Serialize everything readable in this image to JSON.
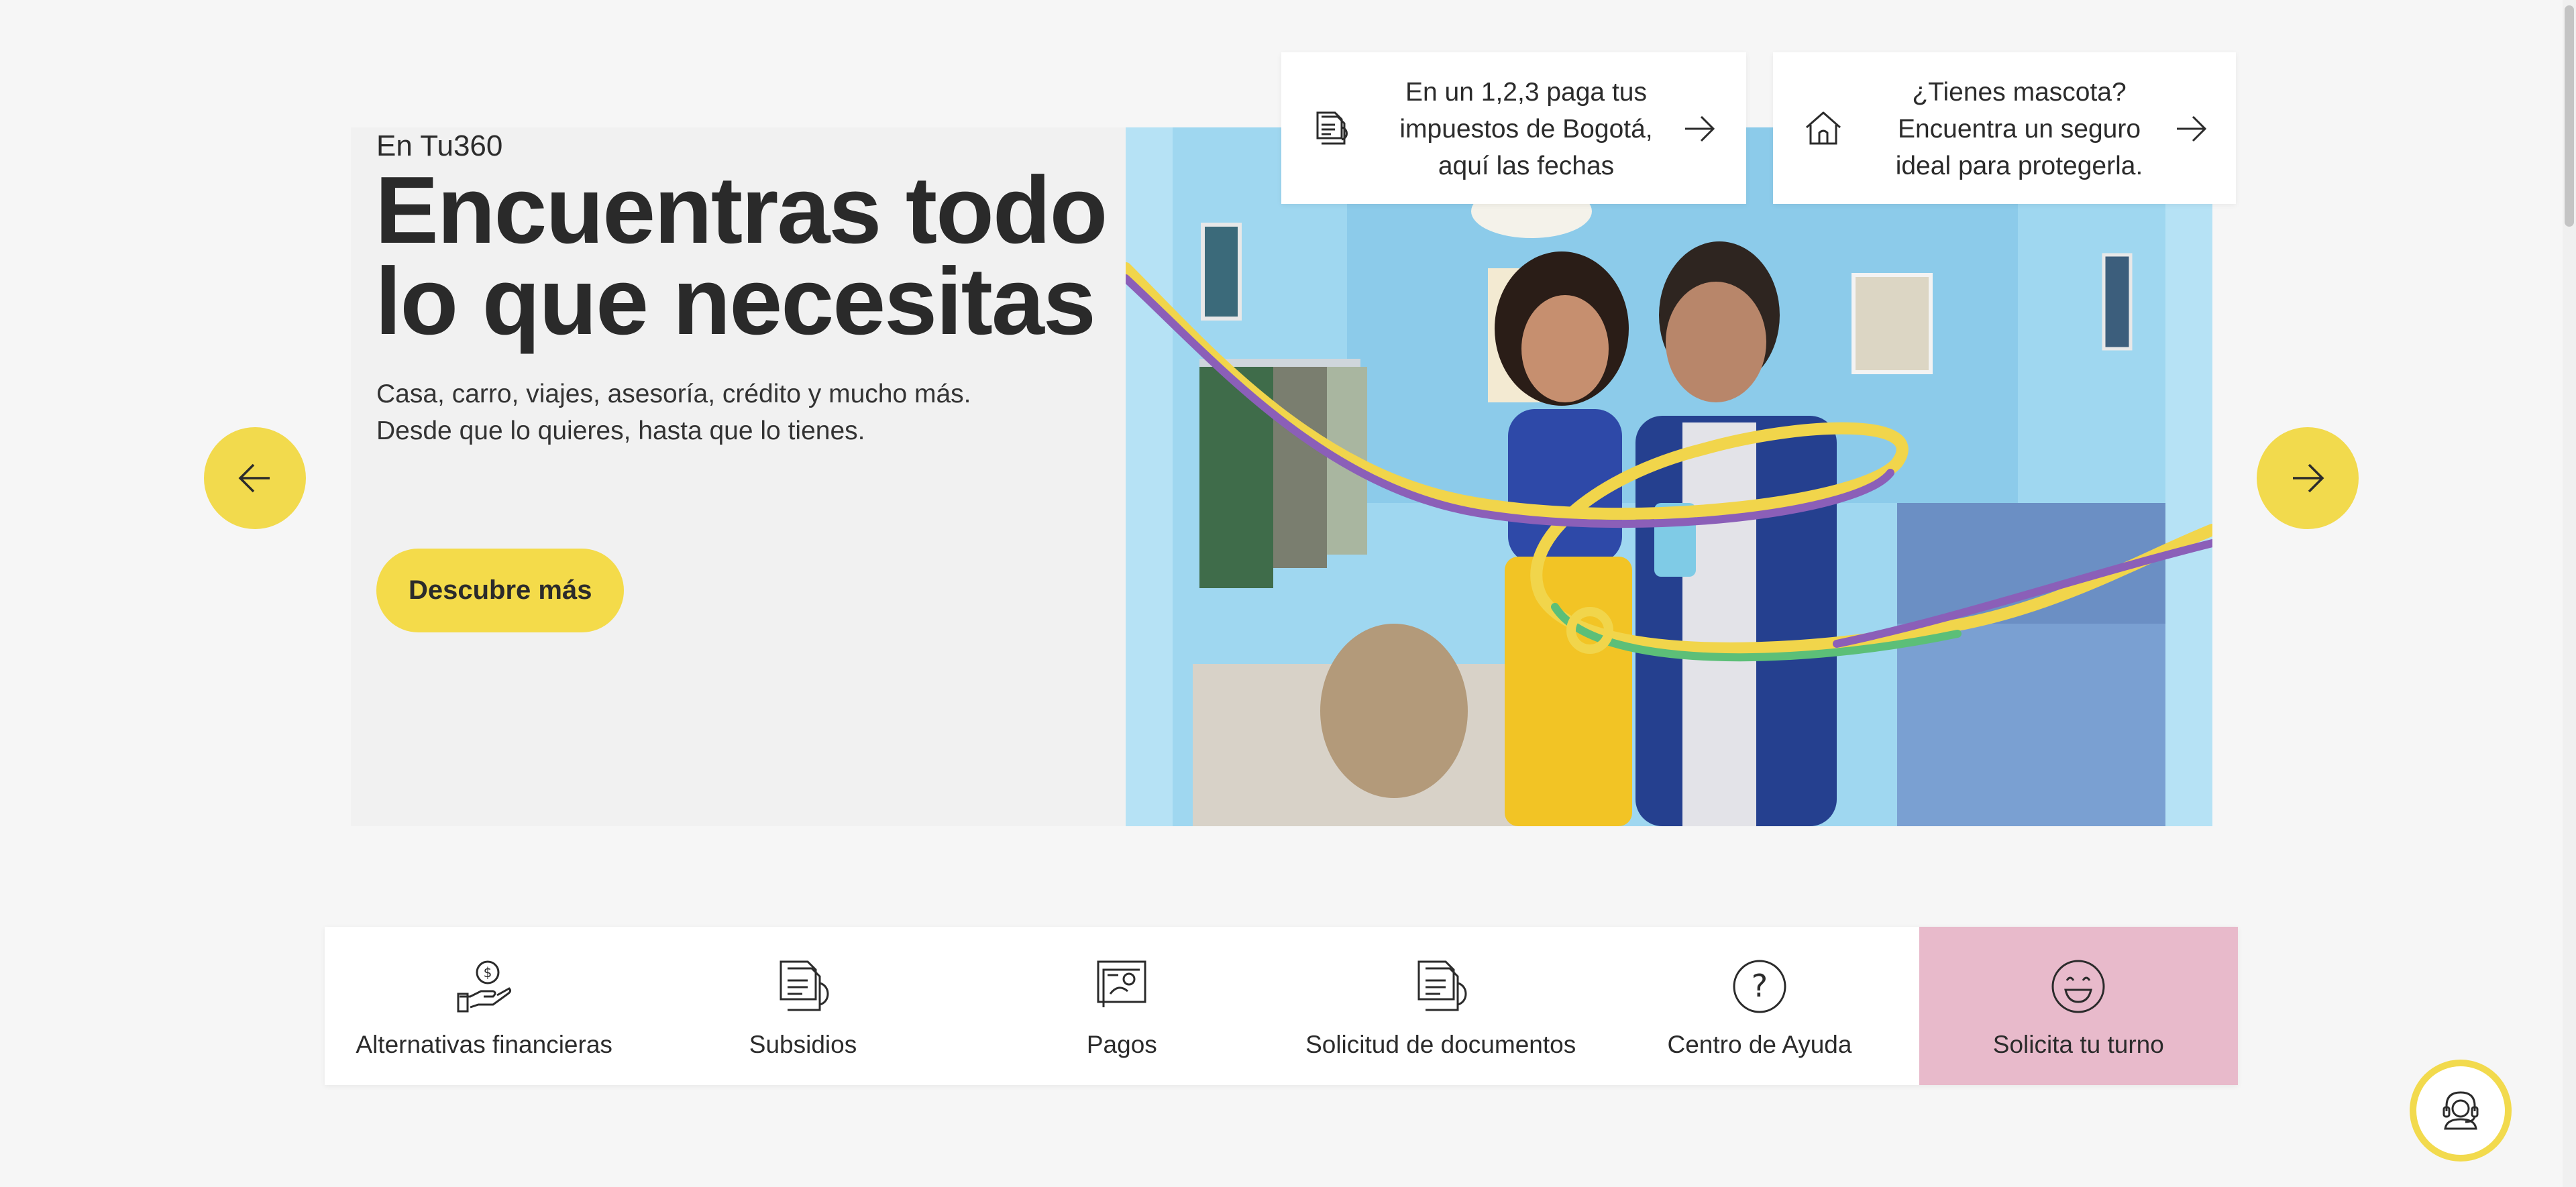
{
  "hero": {
    "eyebrow": "En Tu360",
    "headline": "Encuentras todo lo que necesitas",
    "subline_1": "Casa, carro, viajes, asesoría, crédito y mucho más.",
    "subline_2": "Desde que lo quieres, hasta que lo tienes.",
    "cta_label": "Descubre más"
  },
  "promos": [
    {
      "icon": "document-icon",
      "line_1": "En un 1,2,3 paga tus",
      "line_2": "impuestos de Bogotá,",
      "line_3": "aquí las fechas"
    },
    {
      "icon": "home-icon",
      "line_1": "¿Tienes mascota?",
      "line_2": "Encuentra un seguro",
      "line_3": "ideal para protegerla."
    }
  ],
  "carousel": {
    "prev_icon": "arrow-left-icon",
    "next_icon": "arrow-right-icon"
  },
  "quick_access": [
    {
      "icon": "money-hand-icon",
      "label": "Alternativas financieras"
    },
    {
      "icon": "subsidy-document-icon",
      "label": "Subsidios"
    },
    {
      "icon": "payments-icon",
      "label": "Pagos"
    },
    {
      "icon": "document-request-icon",
      "label": "Solicitud de documentos"
    },
    {
      "icon": "help-icon",
      "label": "Centro de Ayuda"
    },
    {
      "icon": "smiley-icon",
      "label": "Solicita tu turno"
    }
  ],
  "colors": {
    "accent_yellow": "#f2da4d",
    "highlight_pink": "#e8bacb",
    "background": "#f6f6f6"
  },
  "assistant": {
    "icon": "support-agent-icon"
  }
}
